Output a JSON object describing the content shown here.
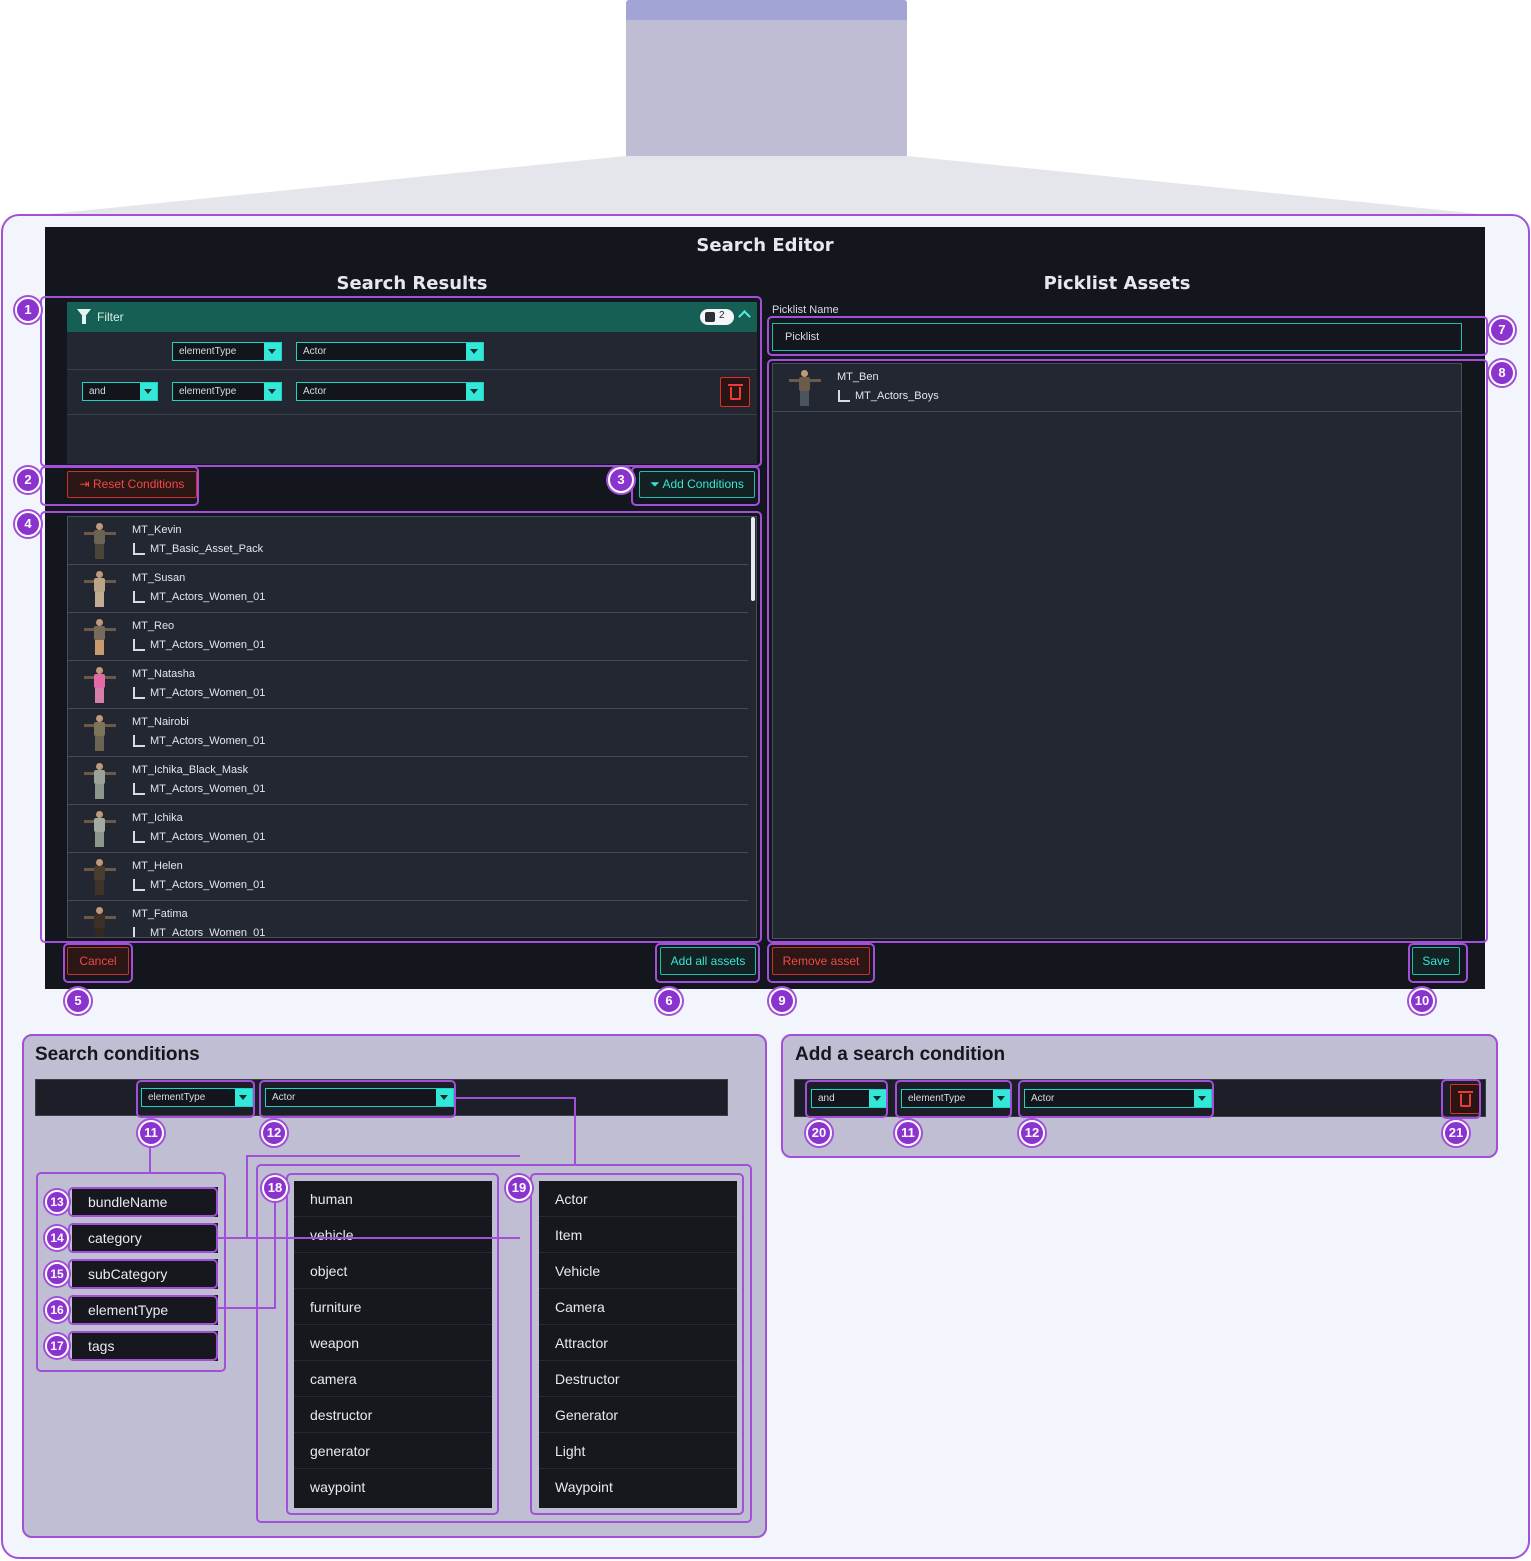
{
  "editor": {
    "title": "Search Editor",
    "search_results_title": "Search Results",
    "picklist_assets_title": "Picklist Assets",
    "filter": {
      "label": "Filter",
      "count": "2",
      "rows": [
        {
          "operator": "",
          "key": "elementType",
          "value": "Actor"
        },
        {
          "operator": "and",
          "key": "elementType",
          "value": "Actor"
        }
      ]
    },
    "reset_conditions_label": "Reset Conditions",
    "add_conditions_label": "Add Conditions",
    "results": [
      {
        "name": "MT_Kevin",
        "bundle": "MT_Basic_Asset_Pack"
      },
      {
        "name": "MT_Susan",
        "bundle": "MT_Actors_Women_01"
      },
      {
        "name": "MT_Reo",
        "bundle": "MT_Actors_Women_01"
      },
      {
        "name": "MT_Natasha",
        "bundle": "MT_Actors_Women_01"
      },
      {
        "name": "MT_Nairobi",
        "bundle": "MT_Actors_Women_01"
      },
      {
        "name": "MT_Ichika_Black_Mask",
        "bundle": "MT_Actors_Women_01"
      },
      {
        "name": "MT_Ichika",
        "bundle": "MT_Actors_Women_01"
      },
      {
        "name": "MT_Helen",
        "bundle": "MT_Actors_Women_01"
      },
      {
        "name": "MT_Fatima",
        "bundle": "MT_Actors_Women_01"
      }
    ],
    "cancel_label": "Cancel",
    "add_all_assets_label": "Add all assets",
    "picklist_name_label": "Picklist Name",
    "picklist_name_value": "Picklist",
    "picklist_items": [
      {
        "name": "MT_Ben",
        "bundle": "MT_Actors_Boys"
      }
    ],
    "remove_asset_label": "Remove asset",
    "save_label": "Save"
  },
  "callouts": [
    "1",
    "2",
    "3",
    "4",
    "5",
    "6",
    "7",
    "8",
    "9",
    "10",
    "11",
    "12",
    "13",
    "14",
    "15",
    "16",
    "17",
    "18",
    "19",
    "20",
    "21"
  ],
  "search_conditions": {
    "title": "Search conditions",
    "key_dropdown": "elementType",
    "value_dropdown": "Actor",
    "keys": [
      "bundleName",
      "category",
      "subCategory",
      "elementType",
      "tags"
    ],
    "categories": [
      "human",
      "vehicle",
      "object",
      "furniture",
      "weapon",
      "camera",
      "destructor",
      "generator",
      "waypoint"
    ],
    "element_types": [
      "Actor",
      "Item",
      "Vehicle",
      "Camera",
      "Attractor",
      "Destructor",
      "Generator",
      "Light",
      "Waypoint"
    ]
  },
  "add_condition": {
    "title": "Add a search condition",
    "operator": "and",
    "key_dropdown": "elementType",
    "value_dropdown": "Actor"
  },
  "colors": {
    "accent": "#a24fd9",
    "teal": "#1fd2c2",
    "danger": "#d9302e",
    "editor_bg": "#13161c"
  }
}
